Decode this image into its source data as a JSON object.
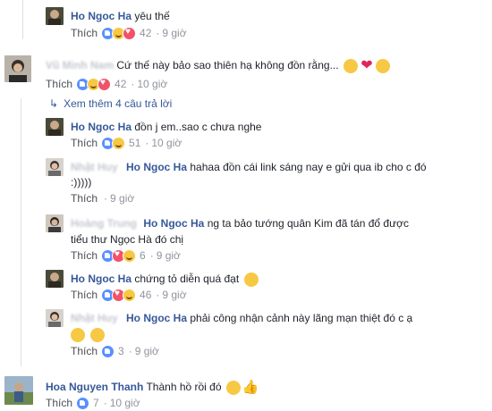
{
  "colors": {
    "link": "#365899",
    "meta": "#90949c",
    "like_blue": "#5890ff",
    "love_red": "#f25268",
    "haha_yellow": "#f7c844"
  },
  "ui": {
    "like_label": "Thích",
    "dot": "·"
  },
  "comments": [
    {
      "author": "Ho Ngoc Ha",
      "text": "yêu thế",
      "reactions": [
        "like",
        "haha",
        "love"
      ],
      "count": "42",
      "time": "9 giờ"
    },
    {
      "author": "Vũ Minh Nam",
      "text": "Cứ thế này bảo sao thiên hạ không đồn rằng...",
      "emojis": [
        "thinking-emoji",
        "heart-emoji",
        "thinking-emoji"
      ],
      "reactions": [
        "like",
        "haha",
        "love"
      ],
      "count": "42",
      "time": "10 giờ"
    }
  ],
  "more_replies": "Xem thêm 4 câu trả lời",
  "replies": [
    {
      "author": "Ho Ngoc Ha",
      "text": "đồn j em..sao c chưa nghe",
      "reactions": [
        "like",
        "haha"
      ],
      "count": "51",
      "time": "10 giờ"
    },
    {
      "author_blur": "Nhật Huy",
      "tag": "Ho Ngoc Ha",
      "text": "hahaa đồn cái link sáng nay e gửi qua ib cho c đó",
      "text2": ":)))))",
      "time": "9 giờ"
    },
    {
      "author_blur": "Hoàng Trung",
      "tag": "Ho Ngoc Ha",
      "text": "ng ta bảo tướng quân Kim đã tán đổ được",
      "text2": "tiểu thư Ngọc Hà đó chị",
      "reactions": [
        "like",
        "love",
        "haha"
      ],
      "count": "6",
      "time": "9 giờ"
    },
    {
      "author": "Ho Ngoc Ha",
      "text": "chứng tỏ diễn quá đạt",
      "emojis": [
        "tongue-emoji"
      ],
      "reactions": [
        "like",
        "love",
        "haha"
      ],
      "count": "46",
      "time": "9 giờ"
    },
    {
      "author_blur": "Nhật Huy",
      "tag": "Ho Ngoc Ha",
      "text": "phải công nhận cảnh này lãng mạn thiệt đó c ạ",
      "emojis2": [
        "laughing-emoji",
        "heart-eyes-emoji"
      ],
      "reactions": [
        "like"
      ],
      "count": "3",
      "time": "9 giờ"
    }
  ],
  "last": {
    "author": "Hoa Nguyen Thanh",
    "text": "Thành hồ rồi đó",
    "emojis": [
      "tongue-emoji",
      "thumbs-up-emoji"
    ],
    "reactions": [
      "like"
    ],
    "count": "7",
    "time": "10 giờ"
  }
}
